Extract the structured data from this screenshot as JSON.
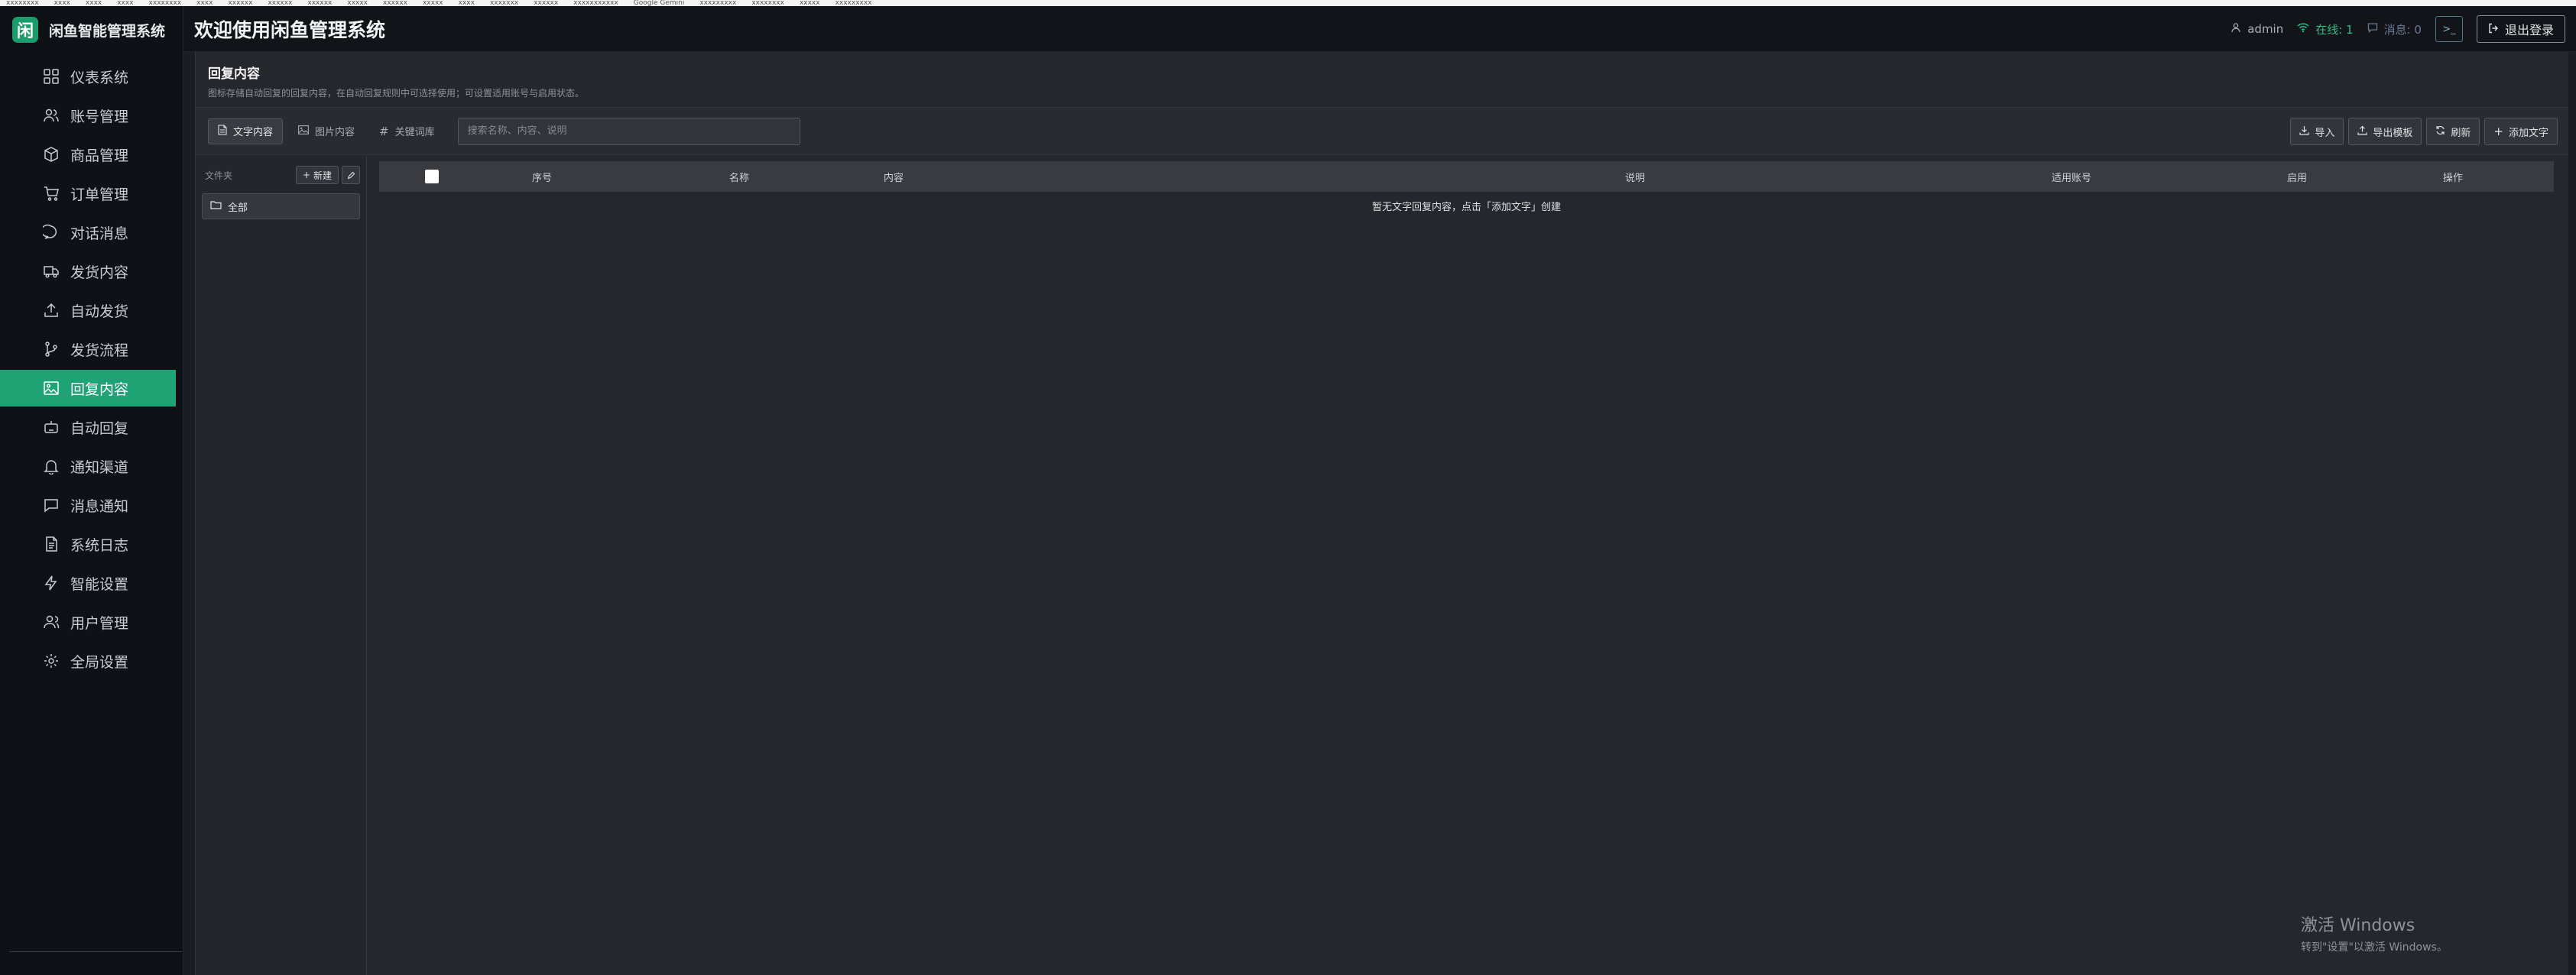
{
  "bookmarks": [
    "xxxxxxxx",
    "xxxx",
    "xxxx",
    "xxxx",
    "xxxxxxxx",
    "xxxx",
    "xxxxxx",
    "xxxxxx",
    "xxxxxx",
    "xxxxx",
    "xxxxxx",
    "xxxxx",
    "xxxx",
    "xxxxxxx",
    "xxxxxx",
    "xxxxxxxxxxx",
    "Google Gemini",
    "xxxxxxxxx",
    "xxxxxxxx",
    "xxxxx",
    "xxxxxxxxx"
  ],
  "brand": {
    "logo": "闲",
    "name": "闲鱼智能管理系统"
  },
  "nav": [
    {
      "label": "仪表系统",
      "icon": "dashboard-icon"
    },
    {
      "label": "账号管理",
      "icon": "users-icon"
    },
    {
      "label": "商品管理",
      "icon": "box-icon"
    },
    {
      "label": "订单管理",
      "icon": "cart-icon"
    },
    {
      "label": "对话消息",
      "icon": "chat-icon"
    },
    {
      "label": "发货内容",
      "icon": "truck-icon"
    },
    {
      "label": "自动发货",
      "icon": "upload-icon"
    },
    {
      "label": "发货流程",
      "icon": "branch-icon"
    },
    {
      "label": "回复内容",
      "icon": "image-icon"
    },
    {
      "label": "自动回复",
      "icon": "robot-icon"
    },
    {
      "label": "通知渠道",
      "icon": "bell-icon"
    },
    {
      "label": "消息通知",
      "icon": "message-icon"
    },
    {
      "label": "系统日志",
      "icon": "log-icon"
    },
    {
      "label": "智能设置",
      "icon": "bolt-icon"
    },
    {
      "label": "用户管理",
      "icon": "user-manage-icon"
    },
    {
      "label": "全局设置",
      "icon": "gear-icon"
    }
  ],
  "header": {
    "title": "欢迎使用闲鱼管理系统",
    "user": "admin",
    "online": "在线: 1",
    "messages": "消息: 0",
    "terminal": ">_",
    "logout": "退出登录"
  },
  "page": {
    "title": "回复内容",
    "description": "图标存储自动回复的回复内容，在自动回复规则中可选择使用；可设置适用账号与启用状态。"
  },
  "toolbar": {
    "tabs": [
      "文字内容",
      "图片内容",
      "关键词库"
    ],
    "search_placeholder": "搜索名称、内容、说明",
    "actions": [
      "导入",
      "导出模板",
      "刷新",
      "添加文字"
    ]
  },
  "folders": {
    "header": "文件夹",
    "new_label": "新建",
    "all_label": "全部"
  },
  "table": {
    "columns": [
      "序号",
      "名称",
      "内容",
      "说明",
      "适用账号",
      "启用",
      "操作"
    ],
    "empty_text": "暂无文字回复内容，点击「添加文字」创建"
  },
  "watermark": {
    "title": "激活 Windows",
    "subtitle": "转到\"设置\"以激活 Windows。"
  },
  "colors": {
    "accent": "#1fa374",
    "online": "#2ebd85"
  }
}
